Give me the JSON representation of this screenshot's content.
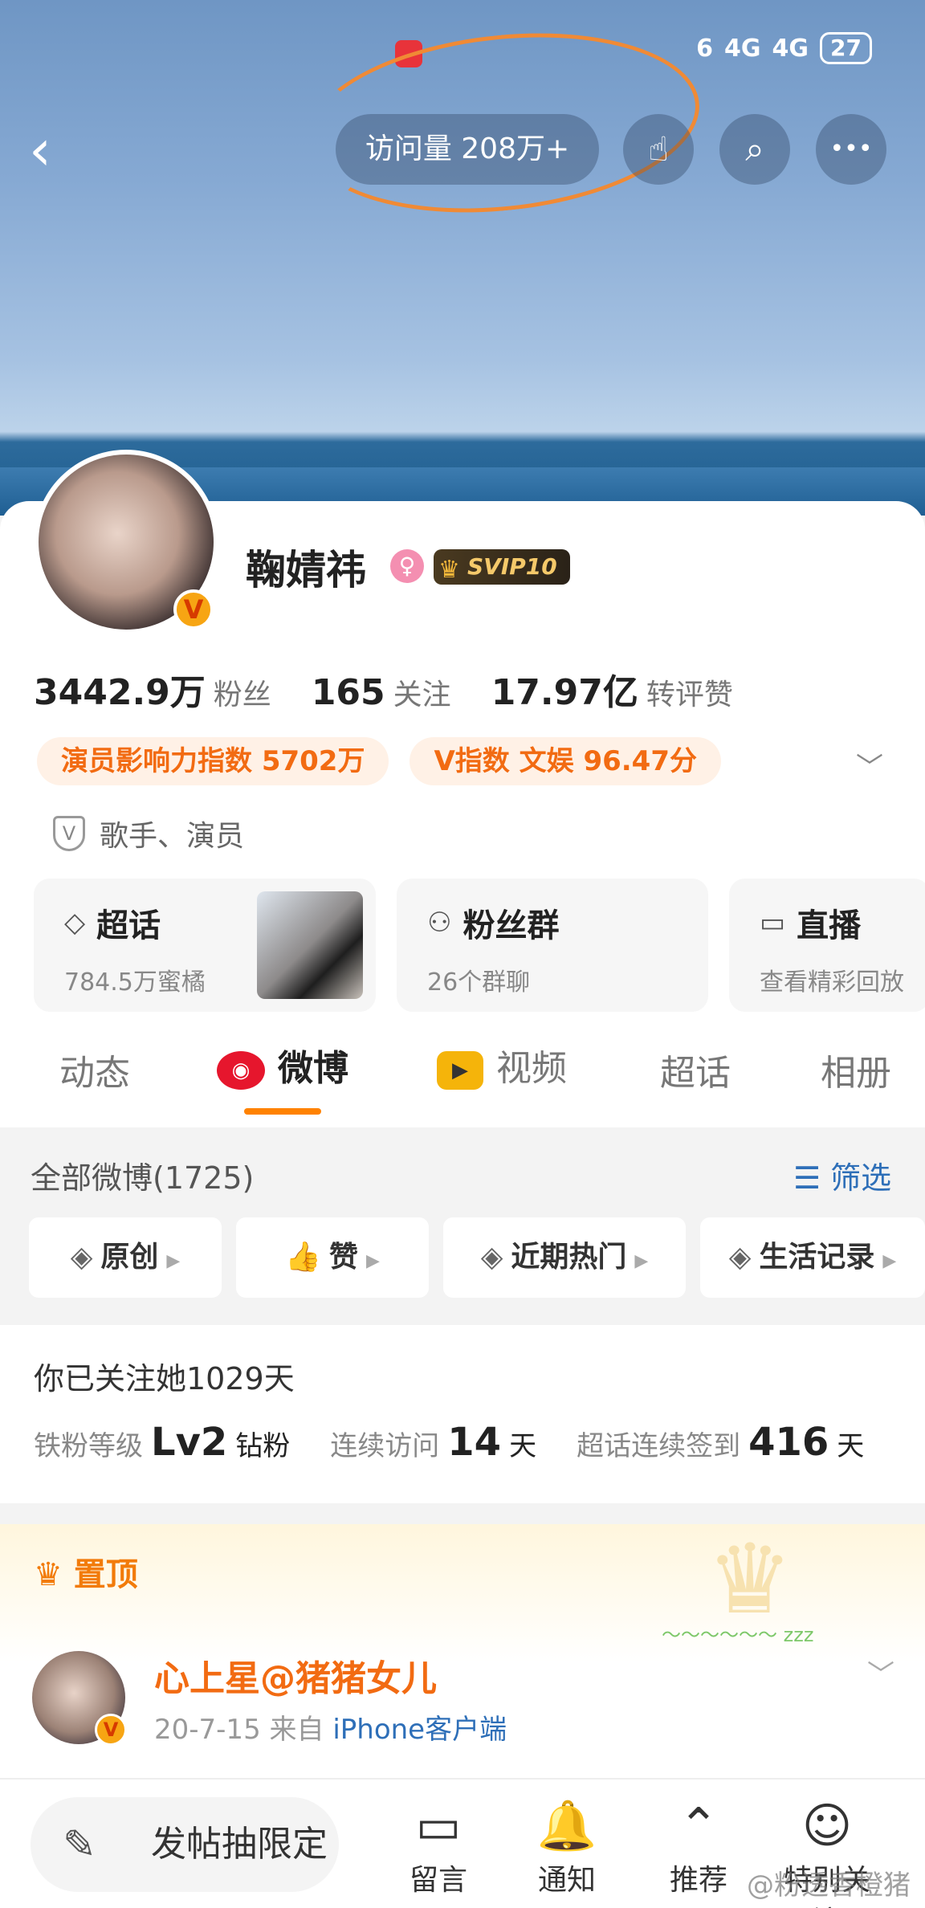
{
  "status_bar": {
    "signal1": "4G",
    "signal2": "4G",
    "battery": "27",
    "wifi": "6"
  },
  "header": {
    "back_icon": "‹",
    "visits": "访问量 208万+",
    "gift_icon": "☝",
    "search_icon": "⌕",
    "more_icon": "•••"
  },
  "profile": {
    "name": "鞠婧祎",
    "gender_icon": "♀",
    "svip": "SVIP10",
    "v_badge": "V",
    "stats": [
      {
        "value": "3442.9万",
        "label": "粉丝"
      },
      {
        "value": "165",
        "label": "关注"
      },
      {
        "value": "17.97亿",
        "label": "转评赞"
      }
    ],
    "tags": [
      "演员影响力指数 5702万",
      "V指数 文娱 96.47分"
    ],
    "verification": "歌手、演员",
    "entries": [
      {
        "icon": "◇",
        "title": "超话",
        "sub": "784.5万蜜橘"
      },
      {
        "icon": "⚇",
        "title": "粉丝群",
        "sub": "26个群聊"
      },
      {
        "icon": "▭",
        "title": "直播",
        "sub": "查看精彩回放"
      }
    ]
  },
  "tabs": [
    "动态",
    "微博",
    "视频",
    "超话",
    "相册"
  ],
  "filter": {
    "heading": "全部微博(1725)",
    "filter_btn": "筛选",
    "chips": [
      "原创",
      "赞",
      "近期热门",
      "生活记录"
    ]
  },
  "fan_info": {
    "days_text": "你已关注她1029天",
    "level_label": "铁粉等级",
    "level_value": "Lv2",
    "level_unit": "钻粉",
    "visit_label": "连续访问",
    "visit_value": "14",
    "visit_unit": "天",
    "checkin_label": "超话连续签到",
    "checkin_value": "416",
    "checkin_unit": "天"
  },
  "pinned": {
    "label": "置顶",
    "author": "心上星@猪猪女儿",
    "date": "20-7-15",
    "from": "来自",
    "source": "iPhone客户端"
  },
  "bottom_bar": {
    "compose": "发帖抽限定",
    "nav": [
      "留言",
      "通知",
      "推荐",
      "特别关注"
    ]
  },
  "watermark": "@粉透香橙猪",
  "colors": {
    "accent": "#ff8200",
    "link": "#2e6fb8",
    "tag_text": "#f26b12",
    "tag_bg": "#fff1e6"
  }
}
